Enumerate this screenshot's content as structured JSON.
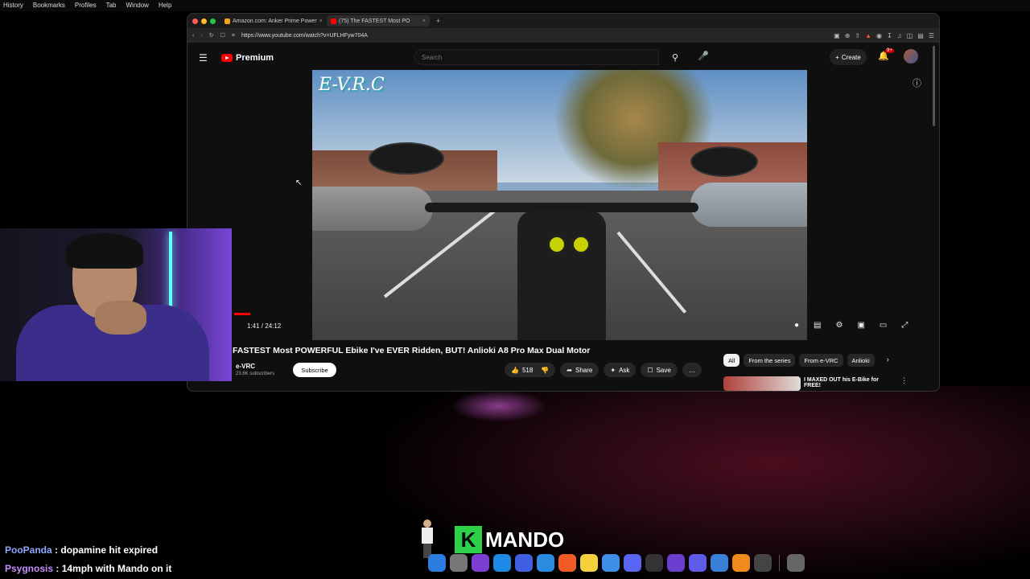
{
  "menubar": [
    "History",
    "Bookmarks",
    "Profiles",
    "Tab",
    "Window",
    "Help"
  ],
  "browser": {
    "tabs": [
      {
        "label": "Amazon.com: Anker Prime Power",
        "fav_color": "#f7a21b",
        "active": false
      },
      {
        "label": "(75) The FASTEST Most PO",
        "fav_color": "#ff0000",
        "active": true
      }
    ],
    "tab_close": "×",
    "new_tab": "+",
    "url": "https://www.youtube.com/watch?v=UFLHFyw704A"
  },
  "youtube": {
    "logo_text": "Premium",
    "search_placeholder": "Search",
    "create_label": "Create",
    "notif_count": "9+",
    "video": {
      "watermark": "E-V.R.C",
      "time": "1:41 / 24:12",
      "progress": 0.07
    },
    "title": "FASTEST Most POWERFUL Ebike I've EVER Ridden, BUT! Anlioki A8 Pro Max Dual Motor",
    "channel": "e-VRC",
    "subscribers": "23.6K subscribers",
    "subscribe_label": "Subscribe",
    "likes": "518",
    "share_label": "Share",
    "ask_label": "Ask",
    "save_label": "Save",
    "chips": [
      "All",
      "From the series",
      "From e-VRC",
      "Anlioki"
    ],
    "rec_title": "I MAXED OUT his E-Bike for FREE!"
  },
  "chat": [
    {
      "user": "PooPanda",
      "message": "dopamine hit expired"
    },
    {
      "user": "Psygnosis",
      "message": "14mph with Mando on it"
    }
  ],
  "overlay": {
    "k": "K",
    "name": "MANDO"
  },
  "dock": [
    {
      "name": "finder",
      "color": "#2d7de0"
    },
    {
      "name": "system-settings",
      "color": "#777"
    },
    {
      "name": "tor",
      "color": "#7a3fd0"
    },
    {
      "name": "app-store",
      "color": "#1e88e5"
    },
    {
      "name": "arc",
      "color": "#3f5fe0"
    },
    {
      "name": "safari",
      "color": "#2a8be0"
    },
    {
      "name": "brave",
      "color": "#f25b24"
    },
    {
      "name": "notes",
      "color": "#f5d03a"
    },
    {
      "name": "mail",
      "color": "#3d8fe8"
    },
    {
      "name": "discord",
      "color": "#5865f2"
    },
    {
      "name": "activity",
      "color": "#333"
    },
    {
      "name": "view",
      "color": "#6a3fd0"
    },
    {
      "name": "launchpad",
      "color": "#5e5ce6"
    },
    {
      "name": "finder2",
      "color": "#3a7fd8"
    },
    {
      "name": "vlc",
      "color": "#f08a1c"
    },
    {
      "name": "obs",
      "color": "#444"
    },
    {
      "name": "trash",
      "color": "#666"
    }
  ]
}
